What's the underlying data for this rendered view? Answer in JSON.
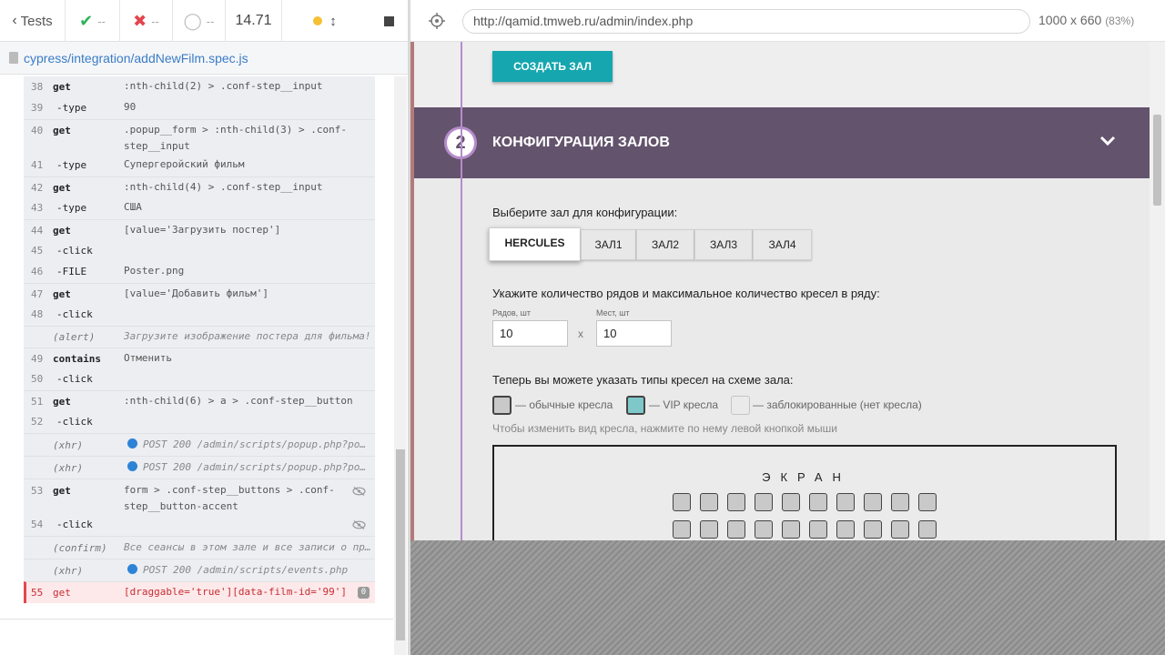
{
  "topbar": {
    "tests_label": "Tests",
    "passed": "--",
    "failed": "--",
    "pending": "--",
    "duration": "14.71"
  },
  "spec_path": "cypress/integration/addNewFilm.spec.js",
  "commands": [
    {
      "num": "38",
      "name": "get",
      "msg": ":nth-child(2) > .conf-step__input"
    },
    {
      "num": "39",
      "name": "-type",
      "msg": "90"
    },
    {
      "num": "40",
      "name": "get",
      "msg": ".popup__form > :nth-child(3) > .conf-step__input"
    },
    {
      "num": "41",
      "name": "-type",
      "msg": "Супергеройский фильм"
    },
    {
      "num": "42",
      "name": "get",
      "msg": ":nth-child(4) > .conf-step__input"
    },
    {
      "num": "43",
      "name": "-type",
      "msg": "США"
    },
    {
      "num": "44",
      "name": "get",
      "msg": "[value='Загрузить постер']"
    },
    {
      "num": "45",
      "name": "-click",
      "msg": ""
    },
    {
      "num": "46",
      "name": "-FILE",
      "msg": "Poster.png"
    },
    {
      "num": "47",
      "name": "get",
      "msg": "[value='Добавить фильм']"
    },
    {
      "num": "48",
      "name": "-click",
      "msg": ""
    },
    {
      "num": "",
      "name": "(alert)",
      "msg": "Загрузите изображение постера для фильма!"
    },
    {
      "num": "49",
      "name": "contains",
      "msg": "Отменить"
    },
    {
      "num": "50",
      "name": "-click",
      "msg": ""
    },
    {
      "num": "51",
      "name": "get",
      "msg": ":nth-child(6) > a > .conf-step__button"
    },
    {
      "num": "52",
      "name": "-click",
      "msg": ""
    },
    {
      "num": "",
      "name": "(xhr)",
      "msg": "POST 200 /admin/scripts/popup.php?po…"
    },
    {
      "num": "",
      "name": "(xhr)",
      "msg": "POST 200 /admin/scripts/popup.php?po…"
    },
    {
      "num": "53",
      "name": "get",
      "msg": "form > .conf-step__buttons > .conf-step__button-accent"
    },
    {
      "num": "54",
      "name": "-click",
      "msg": ""
    },
    {
      "num": "",
      "name": "(confirm)",
      "msg": "Все сеансы в этом зале и все записи о пр…"
    },
    {
      "num": "",
      "name": "(xhr)",
      "msg": "POST 200 /admin/scripts/events.php"
    },
    {
      "num": "55",
      "name": "get",
      "msg": "[draggable='true'][data-film-id='99']",
      "badge": "0"
    }
  ],
  "browser": {
    "url": "http://qamid.tmweb.ru/admin/index.php",
    "viewport": "1000 x 660",
    "zoom": "(83%)"
  },
  "app": {
    "create_hall_button": "СОЗДАТЬ ЗАЛ",
    "section_number": "2",
    "section_title": "КОНФИГУРАЦИЯ ЗАЛОВ",
    "choose_hall_label": "Выберите зал для конфигурации:",
    "halls": [
      "HERCULES",
      "ЗАЛ1",
      "ЗАЛ2",
      "ЗАЛ3",
      "ЗАЛ4"
    ],
    "selected_hall": "HERCULES",
    "rows_seats_label": "Укажите количество рядов и максимальное количество кресел в ряду:",
    "rows_label": "Рядов, шт",
    "rows_value": "10",
    "seats_label": "Мест, шт",
    "seats_value": "10",
    "x_sign": "x",
    "seat_types_label": "Теперь вы можете указать типы кресел на схеме зала:",
    "legend_standard": "— обычные кресла",
    "legend_vip": "— VIP кресла",
    "legend_blocked": "— заблокированные (нет кресла)",
    "seat_hint": "Чтобы изменить вид кресла, нажмите по нему левой кнопкой мыши",
    "screen_label": "ЭКРАН"
  },
  "colors": {
    "accent_teal": "#16a6af",
    "section_header": "#63536c",
    "timeline_purple": "#b58ccb",
    "passed_green": "#2fb35a",
    "failed_red": "#e2474d",
    "link_blue": "#3a7cc7"
  }
}
